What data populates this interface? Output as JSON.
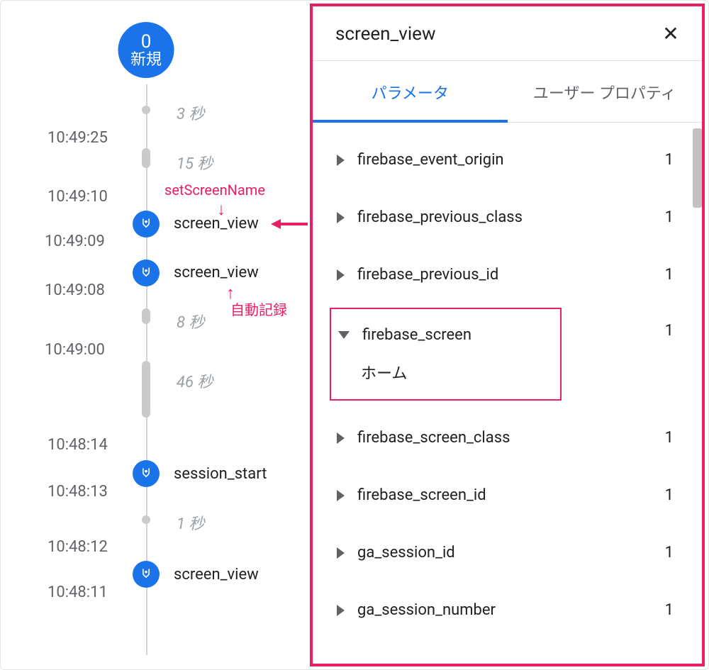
{
  "badge": {
    "count": "0",
    "label": "新規"
  },
  "timestamps": {
    "t1": "10:49:25",
    "t2": "10:49:10",
    "t3": "10:49:09",
    "t4": "10:49:08",
    "t5": "10:49:00",
    "t6": "10:48:14",
    "t7": "10:48:13",
    "t8": "10:48:12",
    "t9": "10:48:11"
  },
  "durations": {
    "d1": "3 秒",
    "d2": "15 秒",
    "d3": "8 秒",
    "d4": "46 秒",
    "d5": "1 秒"
  },
  "events": {
    "e1": "screen_view",
    "e2": "screen_view",
    "e3": "session_start",
    "e4": "screen_view"
  },
  "annotations": {
    "a1": "setScreenName",
    "a2": "自動記録"
  },
  "panel": {
    "title": "screen_view",
    "tabs": {
      "params": "パラメータ",
      "userprops": "ユーザー プロパティ"
    },
    "params": [
      {
        "name": "firebase_event_origin",
        "count": "1"
      },
      {
        "name": "firebase_previous_class",
        "count": "1"
      },
      {
        "name": "firebase_previous_id",
        "count": "1"
      },
      {
        "name": "firebase_screen",
        "count": "1",
        "expanded": true,
        "value": "ホーム"
      },
      {
        "name": "firebase_screen_class",
        "count": "1"
      },
      {
        "name": "firebase_screen_id",
        "count": "1"
      },
      {
        "name": "ga_session_id",
        "count": "1"
      },
      {
        "name": "ga_session_number",
        "count": "1"
      }
    ]
  }
}
